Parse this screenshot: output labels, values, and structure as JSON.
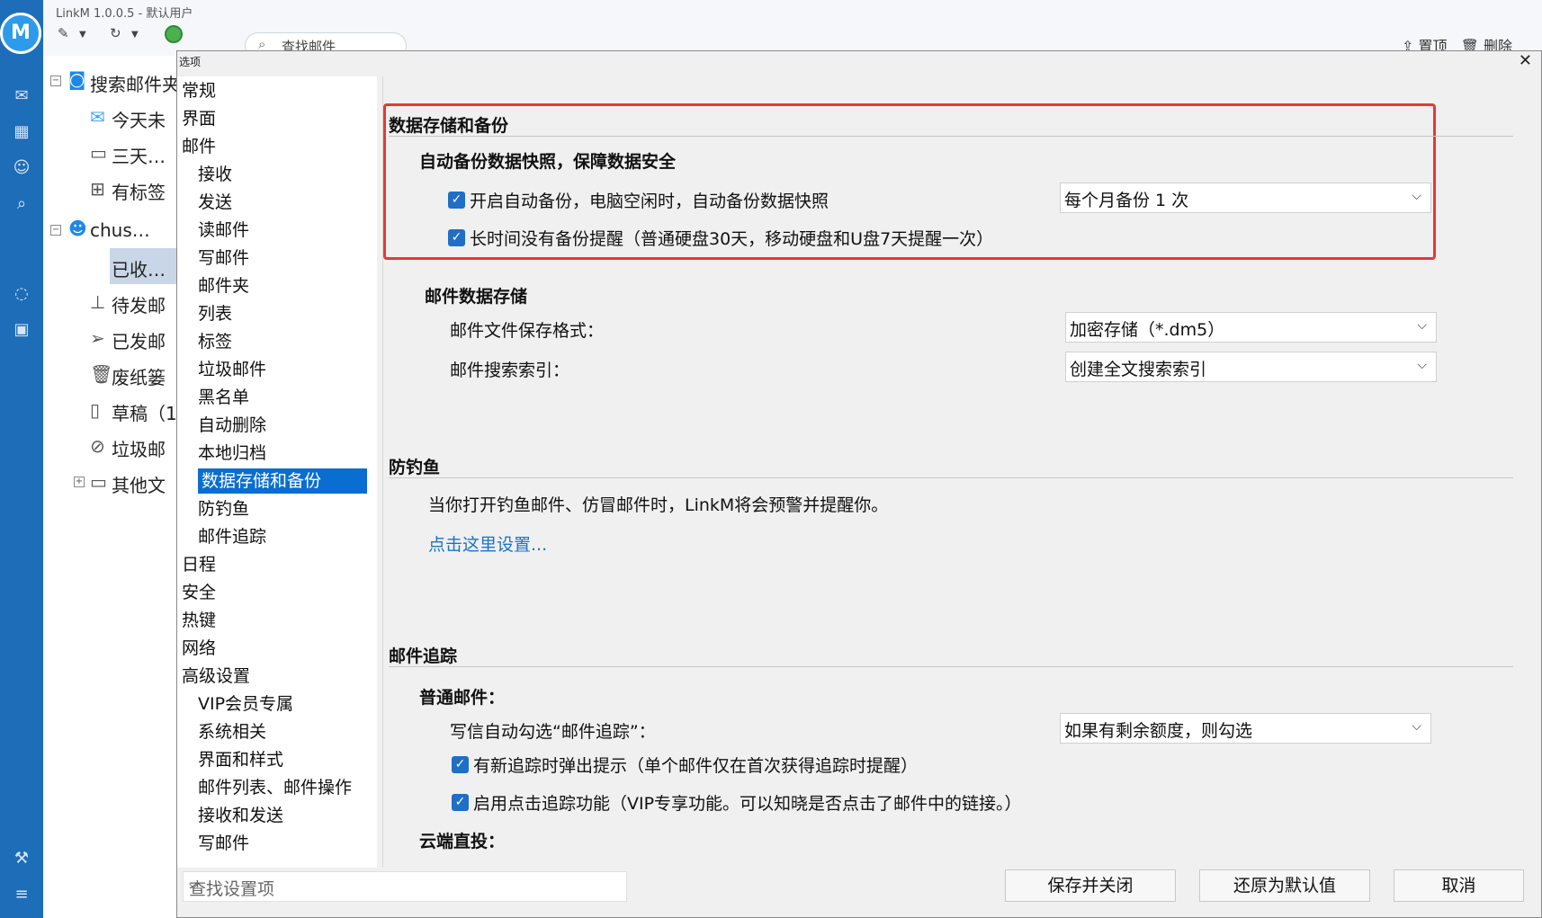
{
  "app": {
    "title": "LinkM 1.0.0.5  -  默认用户",
    "search_placeholder": "查找邮件",
    "pin_label": "置顶",
    "delete_label": "删除"
  },
  "mail_tree": {
    "search_folder": "搜索邮件夹",
    "search_items": [
      "今天未",
      "三天…",
      "有标签"
    ],
    "account": "chus…",
    "account_folders": [
      "已收…",
      "待发邮",
      "已发邮",
      "废纸篓",
      "草稿（1",
      "垃圾邮",
      "其他文"
    ]
  },
  "dialog": {
    "title": "选项",
    "close_icon": "close-icon"
  },
  "nav": {
    "items": [
      {
        "label": "常规",
        "level": 0
      },
      {
        "label": "界面",
        "level": 0
      },
      {
        "label": "邮件",
        "level": 0
      },
      {
        "label": "接收",
        "level": 1
      },
      {
        "label": "发送",
        "level": 1
      },
      {
        "label": "读邮件",
        "level": 1
      },
      {
        "label": "写邮件",
        "level": 1
      },
      {
        "label": "邮件夹",
        "level": 1
      },
      {
        "label": "列表",
        "level": 1
      },
      {
        "label": "标签",
        "level": 1
      },
      {
        "label": "垃圾邮件",
        "level": 1
      },
      {
        "label": "黑名单",
        "level": 1
      },
      {
        "label": "自动删除",
        "level": 1
      },
      {
        "label": "本地归档",
        "level": 1
      },
      {
        "label": "数据存储和备份",
        "level": 1,
        "active": true
      },
      {
        "label": "防钓鱼",
        "level": 1
      },
      {
        "label": "邮件追踪",
        "level": 1
      },
      {
        "label": "日程",
        "level": 0
      },
      {
        "label": "安全",
        "level": 0
      },
      {
        "label": "热键",
        "level": 0
      },
      {
        "label": "网络",
        "level": 0
      },
      {
        "label": "高级设置",
        "level": 0
      },
      {
        "label": "VIP会员专属",
        "level": 1
      },
      {
        "label": "系统相关",
        "level": 1
      },
      {
        "label": "界面和样式",
        "level": 1
      },
      {
        "label": "邮件列表、邮件操作",
        "level": 1
      },
      {
        "label": "接收和发送",
        "level": 1
      },
      {
        "label": "写邮件",
        "level": 1
      }
    ],
    "find_placeholder": "查找设置项"
  },
  "backup": {
    "section_title": "数据存储和备份",
    "subtitle": "自动备份数据快照，保障数据安全",
    "auto_backup_label": "开启自动备份，电脑空闲时，自动备份数据快照",
    "auto_backup_checked": true,
    "frequency_value": "每个月备份 1 次",
    "reminder_label": "长时间没有备份提醒（普通硬盘30天，移动硬盘和U盘7天提醒一次）",
    "reminder_checked": true
  },
  "storage": {
    "title": "邮件数据存储",
    "format_label": "邮件文件保存格式：",
    "format_value": "加密存储（*.dm5）",
    "index_label": "邮件搜索索引：",
    "index_value": "创建全文搜索索引"
  },
  "phishing": {
    "title": "防钓鱼",
    "description": "当你打开钓鱼邮件、仿冒邮件时，LinkM将会预警并提醒你。",
    "link": "点击这里设置..."
  },
  "tracking": {
    "title": "邮件追踪",
    "normal_title": "普通邮件：",
    "auto_check_label": "写信自动勾选“邮件追踪”：",
    "auto_check_value": "如果有剩余额度，则勾选",
    "popup_label": "有新追踪时弹出提示（单个邮件仅在首次获得追踪时提醒）",
    "popup_checked": true,
    "click_label": "启用点击追踪功能（VIP专享功能。可以知晓是否点击了邮件中的链接。）",
    "click_checked": true,
    "cloud_title": "云端直投："
  },
  "buttons": {
    "save_close": "保存并关闭",
    "restore_default": "还原为默认值",
    "cancel": "取消"
  },
  "colors": {
    "rail": "#1e6db8",
    "accent": "#0a6ed1",
    "highlight_border": "#e53935",
    "link": "#1a73c8"
  }
}
